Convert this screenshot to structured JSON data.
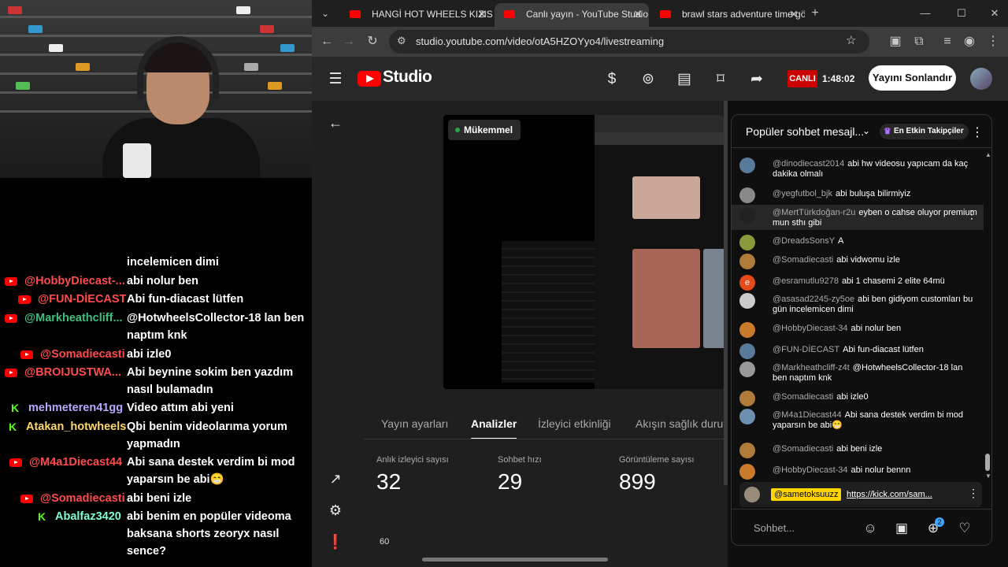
{
  "overlay_chat": [
    {
      "src": "",
      "name": "",
      "text": "incelemicen dimi"
    },
    {
      "src": "yt",
      "name": "@HobbyDiecast-...",
      "color": "#ff4b4b",
      "text": "abi nolur ben"
    },
    {
      "src": "yt",
      "name": "@FUN-DİECAST",
      "color": "#ff4b4b",
      "text": "Abi fun-diacast lütfen"
    },
    {
      "src": "yt",
      "name": "@Markheathcliff...",
      "color": "#3fbf7f",
      "text": "@HotwheelsCollector-18 lan ben naptım knk"
    },
    {
      "src": "yt",
      "name": "@Somadiecasti",
      "color": "#ff4b4b",
      "text": "abi izle0"
    },
    {
      "src": "yt",
      "name": "@BROIJUSTWA...",
      "color": "#ff4b4b",
      "text": "Abi beynine sokim ben yazdım nasıl bulamadın"
    },
    {
      "src": "kick",
      "name": "mehmeteren41gg",
      "color": "#b9a8ff",
      "text": "Video attım abi yeni"
    },
    {
      "src": "kick",
      "name": "Atakan_hotwheels",
      "color": "#ffd86b",
      "text": "Qbi benim videolarıma yorum yapmadın"
    },
    {
      "src": "yt",
      "name": "@M4a1Diecast44",
      "color": "#ff4b4b",
      "text": "Abi sana destek verdim bi mod yaparsın be abi😁"
    },
    {
      "src": "yt",
      "name": "@Somadiecasti",
      "color": "#ff4b4b",
      "text": "abi beni izle"
    },
    {
      "src": "kick",
      "name": "Abalfaz3420",
      "color": "#7fffd4",
      "text": "abi benim en popüler videoma baksana shorts zeoryx nasıl sence?"
    }
  ],
  "browser": {
    "tabs": [
      {
        "label": "HANGİ HOT WHEELS KIZISIN??",
        "close": "✕"
      },
      {
        "label": "Canlı yayın - YouTube Studio",
        "close": "✕"
      },
      {
        "label": "brawl stars adventure time gön",
        "close": "✕"
      }
    ],
    "new_tab": "+",
    "url": "studio.youtube.com/video/otA5HZOYyo4/livestreaming",
    "window_controls": [
      "—",
      "☐",
      "✕"
    ]
  },
  "studio": {
    "logo_text": "Studio",
    "live_badge": "CANLI",
    "live_timer": "1:48:02",
    "end_button": "Yayını Sonlandır",
    "stream_status": "Mükemmel",
    "tabs": [
      "Yayın ayarları",
      "Analizler",
      "İzleyici etkinliği",
      "Akışın sağlık durumu"
    ],
    "active_tab": 1,
    "metrics": [
      {
        "label": "Anlık izleyici sayısı",
        "value": "32"
      },
      {
        "label": "Sohbet hızı",
        "value": "29"
      },
      {
        "label": "Görüntüleme sayısı",
        "value": "899"
      }
    ],
    "chart_tick": "60"
  },
  "chat": {
    "title": "Popüler sohbet mesajl...",
    "top_fans": "En Etkin Takipçiler",
    "messages": [
      {
        "author": "@dinodiecast2014",
        "text": "abi hw videosu yapıcam da kaç dakika olmalı",
        "av": "#5a7a99"
      },
      {
        "author": "@yegfutbol_bjk",
        "text": "abi buluşa bilirmiyiz",
        "av": "#888"
      },
      {
        "author": "@MertTürkdoğan-r2u",
        "text": "eyben o cahse oluyor premium mun sthı gibi",
        "av": "#222"
      },
      {
        "author": "@DreadsSonsY",
        "text": "A",
        "av": "#8a9a3a"
      },
      {
        "author": "@Somadiecasti",
        "text": "abi vidwomu izle",
        "av": "#b07a3a"
      },
      {
        "author": "@esramutlu9278",
        "text": "abi 1 chasemi 2 elite 64mü",
        "av": "#e64a19",
        "initial": "e"
      },
      {
        "author": "@asasad2245-zy5oe",
        "text": "abi ben gidiyom customları bu gün incelemicen dimi",
        "av": "#ccc"
      },
      {
        "author": "@HobbyDiecast-34",
        "text": "abi nolur ben",
        "av": "#c97a2b"
      },
      {
        "author": "@FUN-DİECAST",
        "text": "Abi fun-diacast lütfen",
        "av": "#5a7a99"
      },
      {
        "author": "@Markheathcliff-z4t",
        "text": "@HotwheelsCollector-18 lan ben naptım knk",
        "av": "#999"
      },
      {
        "author": "@Somadiecasti",
        "text": "abi izle0",
        "av": "#b07a3a"
      },
      {
        "author": "@M4a1Diecast44",
        "text": "Abi sana destek verdim bi mod yaparsın be abi😁",
        "av": "#6d8fb0"
      },
      {
        "author": "@Somadiecasti",
        "text": "abi beni izle",
        "av": "#b07a3a"
      },
      {
        "author": "@HobbyDiecast-34",
        "text": "abi nolur bennn",
        "av": "#c97a2b"
      }
    ],
    "pinned_author": "@sametoksuuzz",
    "pinned_link": "https://kick.com/sam...",
    "input_placeholder": "Sohbet...",
    "notif_count": "2"
  }
}
